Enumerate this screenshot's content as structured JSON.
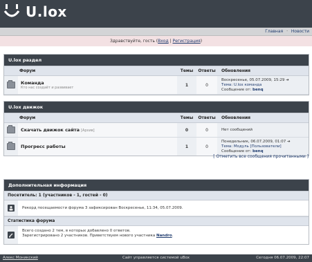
{
  "header": {
    "logo_text": "U.lox",
    "nav": {
      "home": "Главная",
      "news": "Новости"
    }
  },
  "greeting": {
    "prefix": "Здравствуйте, гость (",
    "login": "Вход",
    "sep": " | ",
    "register": "Регистрация",
    "suffix": ")"
  },
  "columns": {
    "forum": "Форум",
    "topics": "Темы",
    "replies": "Ответы",
    "updates": "Обновления"
  },
  "sections": [
    {
      "title": "U.lox раздел",
      "forums": [
        {
          "name": "Команда",
          "desc": "Кто нас создаёт и развивает",
          "topics": "1",
          "replies": "0",
          "last": [
            "Воскресенье, 05.07.2009, 15:29",
            "Тема: U.lox команда",
            "Сообщение от:"
          ],
          "last_author": "benq"
        }
      ]
    },
    {
      "title": "U.lox движок",
      "forums": [
        {
          "name": "Скачать движок сайта",
          "tag": "[Архив]",
          "topics": "0",
          "replies": "0",
          "last": [
            "Нет сообщений"
          ],
          "last_author": ""
        },
        {
          "name": "Прогресс работы",
          "topics": "1",
          "replies": "0",
          "last": [
            "Понедельник, 06.07.2009, 01:07",
            "Тема: Модуль [Пользователи]",
            "Сообщение от:"
          ],
          "last_author": "benq"
        }
      ]
    }
  ],
  "mark_read": "[ Отметить все сообщения прочитанными ]",
  "info": {
    "title": "Дополнительная информация",
    "online_title": "Посетитель: 1 (участников - 1, гостей - 0)",
    "online_text": "Рекорд посещаемости форума 3 зафиксирован Воскресенье, 11:34, 05.07.2009.",
    "stats_title": "Статистика форума",
    "stats_line1": "Всего создано 2 тем, в которых добавлено 0 ответов.",
    "stats_line2_prefix": "Зарегистрировано 2 участников. Приветствуем нового участника ",
    "stats_newest": "Nandro",
    "stats_line2_suffix": "."
  },
  "footer": {
    "left": "Алекс Моникский",
    "center": "Сайт управляется системой uBox",
    "right": "Сегодня 06.07.2009, 22:07"
  },
  "colors": {
    "header_bg": "#3c434b",
    "greeting_bg": "#f3e1e3",
    "column_head_bg": "#dfe4ec"
  }
}
